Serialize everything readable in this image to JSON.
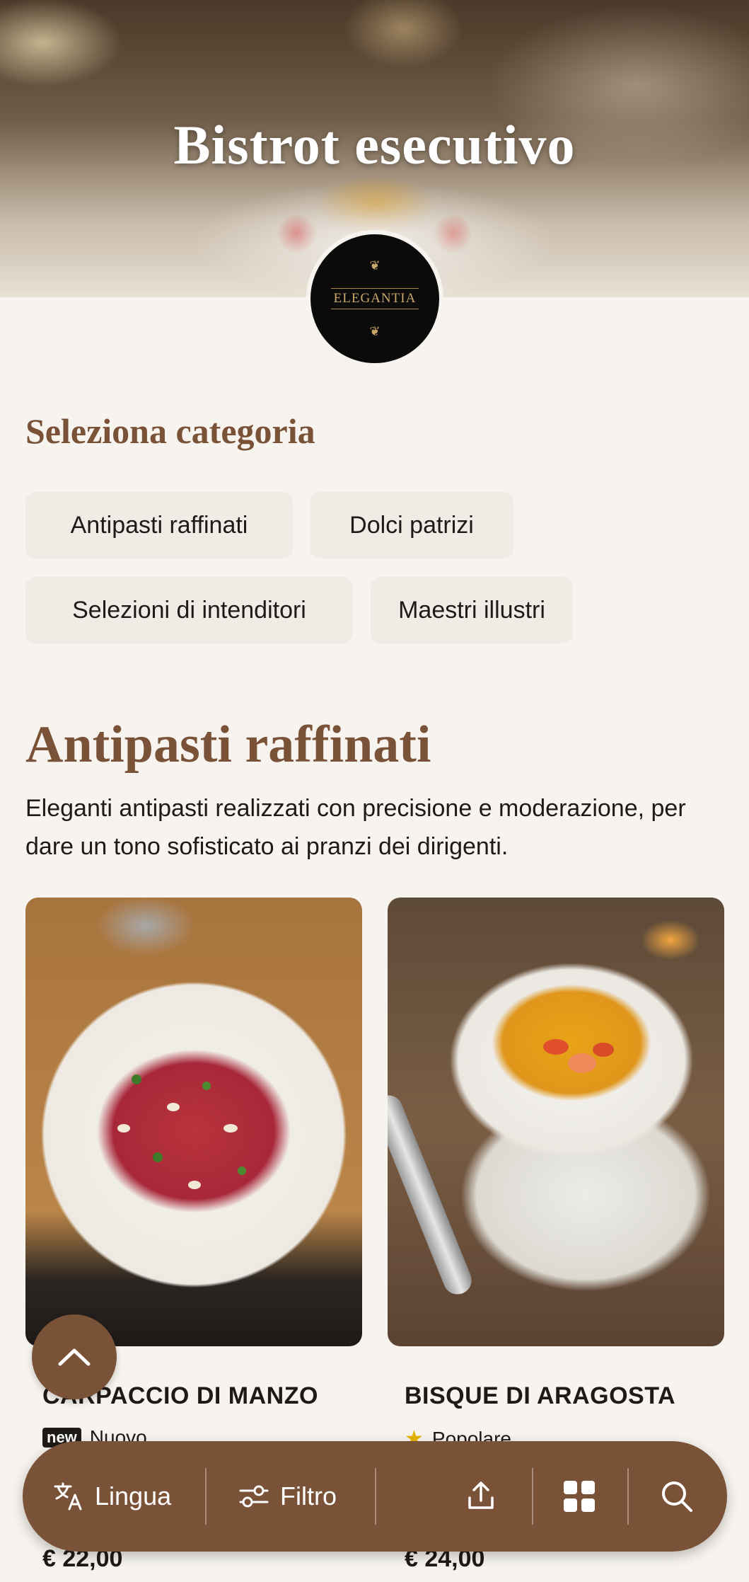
{
  "hero": {
    "title": "Bistrot esecutivo"
  },
  "logo": {
    "text": "ELEGANTIA"
  },
  "category_selector": {
    "heading": "Seleziona categoria",
    "chips": [
      "Antipasti raffinati",
      "Dolci patrizi",
      "Selezioni di intenditori",
      "Maestri illustri"
    ]
  },
  "category": {
    "title": "Antipasti raffinati",
    "description": "Eleganti antipasti realizzati con precisione e moderazione, per dare un tono sofisticato ai pranzi dei dirigenti."
  },
  "items": [
    {
      "name": "CARPACCIO DI MANZO",
      "badge": "new",
      "badge_label": "Nuovo",
      "price": "€ 22,00"
    },
    {
      "name": "BISQUE DI ARAGOSTA",
      "badge_icon": "star-icon",
      "badge_label": "Popolare",
      "price": "€ 24,00"
    }
  ],
  "bottom_bar": {
    "language_label": "Lingua",
    "filter_label": "Filtro"
  },
  "colors": {
    "accent": "#7a5238",
    "background": "#f7f4ef",
    "chip_bg": "#efebe5",
    "star": "#e7b400"
  }
}
